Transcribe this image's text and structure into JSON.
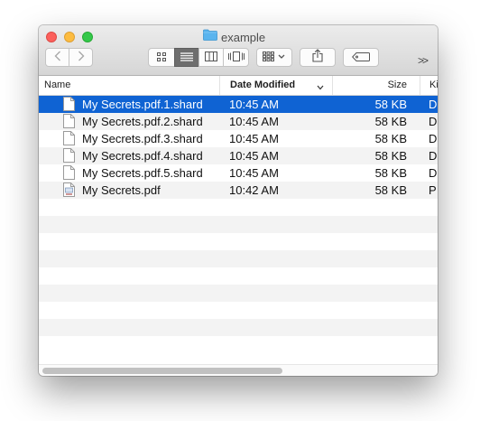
{
  "window": {
    "title": "example",
    "title_icon": "folder-icon"
  },
  "toolbar": {
    "back": "chevron-left-icon",
    "forward": "chevron-right-icon",
    "view_modes": [
      "icon-view-icon",
      "list-view-icon",
      "column-view-icon",
      "cover-flow-icon"
    ],
    "selected_view": "list",
    "arrange": "arrange-icon",
    "share": "share-icon",
    "tags": "tag-icon",
    "overflow": ">>"
  },
  "columns": {
    "name": "Name",
    "date": "Date Modified",
    "size": "Size",
    "kind": "Ki"
  },
  "files": [
    {
      "name": "My Secrets.pdf.1.shard",
      "date": "10:45 AM",
      "size": "58 KB",
      "kind": "D",
      "icon": "document-icon",
      "selected": true
    },
    {
      "name": "My Secrets.pdf.2.shard",
      "date": "10:45 AM",
      "size": "58 KB",
      "kind": "D",
      "icon": "document-icon",
      "selected": false
    },
    {
      "name": "My Secrets.pdf.3.shard",
      "date": "10:45 AM",
      "size": "58 KB",
      "kind": "D",
      "icon": "document-icon",
      "selected": false
    },
    {
      "name": "My Secrets.pdf.4.shard",
      "date": "10:45 AM",
      "size": "58 KB",
      "kind": "D",
      "icon": "document-icon",
      "selected": false
    },
    {
      "name": "My Secrets.pdf.5.shard",
      "date": "10:45 AM",
      "size": "58 KB",
      "kind": "D",
      "icon": "document-icon",
      "selected": false
    },
    {
      "name": "My Secrets.pdf",
      "date": "10:42 AM",
      "size": "58 KB",
      "kind": "P",
      "icon": "pdf-file-icon",
      "selected": false
    }
  ],
  "empty_rows": 9,
  "colors": {
    "selection": "#0f63d3",
    "stripe": "#f3f3f3",
    "folder": "#5ab4ee"
  }
}
